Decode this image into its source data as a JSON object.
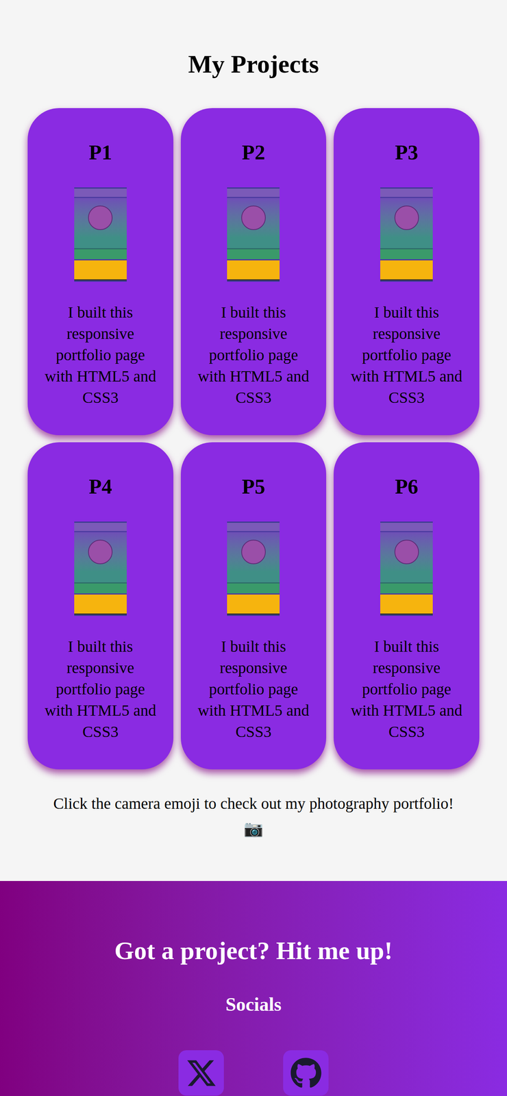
{
  "projects_section": {
    "heading": "My Projects",
    "projects": [
      {
        "title": "P1",
        "description": "I built this responsive portfolio page with HTML5 and CSS3"
      },
      {
        "title": "P2",
        "description": "I built this responsive portfolio page with HTML5 and CSS3"
      },
      {
        "title": "P3",
        "description": "I built this responsive portfolio page with HTML5 and CSS3"
      },
      {
        "title": "P4",
        "description": "I built this responsive portfolio page with HTML5 and CSS3"
      },
      {
        "title": "P5",
        "description": "I built this responsive portfolio page with HTML5 and CSS3"
      },
      {
        "title": "P6",
        "description": "I built this responsive portfolio page with HTML5 and CSS3"
      }
    ],
    "note": "Click the camera emoji to check out my photography portfolio!",
    "camera": "📷"
  },
  "contact": {
    "heading": "Got a project? Hit me up!",
    "socials_heading": "Socials",
    "socials": [
      {
        "kind": "x"
      },
      {
        "kind": "github"
      }
    ]
  }
}
